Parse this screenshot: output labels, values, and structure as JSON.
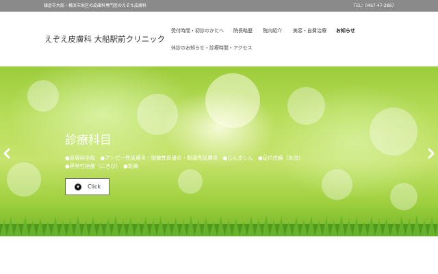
{
  "topbar": {
    "tagline": "鎌倉市大船・横浜市栄区の皮膚科専門医のえぞえ皮膚科",
    "tel": "TEL：0467-47-2887"
  },
  "header": {
    "logo": "えぞえ皮膚科 大船駅前クリニック",
    "nav": {
      "reception": "受付時間・初診のかたへ",
      "director": "院長略歴",
      "tour": "院内紹介",
      "beauty": "美容・自費治療",
      "news": "お知らせ",
      "closed": "休診のお知らせ・診療時間・アクセス"
    }
  },
  "hero": {
    "title": "診療科目",
    "description": "●皮膚科全般　●アトピー性皮膚炎・接触性皮膚炎・脂漏性皮膚炎　●じんましん　●足爪白癬（水虫）●尋常性痤瘡（にきび）　●乾癬",
    "button_label": "Click",
    "prev_arrow": "‹",
    "next_arrow": "›"
  }
}
